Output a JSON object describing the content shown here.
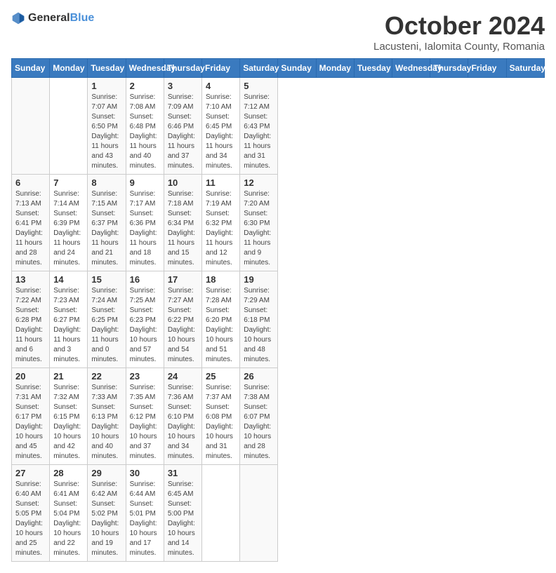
{
  "header": {
    "logo_general": "General",
    "logo_blue": "Blue",
    "month": "October 2024",
    "location": "Lacusteni, Ialomita County, Romania"
  },
  "days_of_week": [
    "Sunday",
    "Monday",
    "Tuesday",
    "Wednesday",
    "Thursday",
    "Friday",
    "Saturday"
  ],
  "weeks": [
    [
      {
        "day": "",
        "info": ""
      },
      {
        "day": "",
        "info": ""
      },
      {
        "day": "1",
        "info": "Sunrise: 7:07 AM\nSunset: 6:50 PM\nDaylight: 11 hours and 43 minutes."
      },
      {
        "day": "2",
        "info": "Sunrise: 7:08 AM\nSunset: 6:48 PM\nDaylight: 11 hours and 40 minutes."
      },
      {
        "day": "3",
        "info": "Sunrise: 7:09 AM\nSunset: 6:46 PM\nDaylight: 11 hours and 37 minutes."
      },
      {
        "day": "4",
        "info": "Sunrise: 7:10 AM\nSunset: 6:45 PM\nDaylight: 11 hours and 34 minutes."
      },
      {
        "day": "5",
        "info": "Sunrise: 7:12 AM\nSunset: 6:43 PM\nDaylight: 11 hours and 31 minutes."
      }
    ],
    [
      {
        "day": "6",
        "info": "Sunrise: 7:13 AM\nSunset: 6:41 PM\nDaylight: 11 hours and 28 minutes."
      },
      {
        "day": "7",
        "info": "Sunrise: 7:14 AM\nSunset: 6:39 PM\nDaylight: 11 hours and 24 minutes."
      },
      {
        "day": "8",
        "info": "Sunrise: 7:15 AM\nSunset: 6:37 PM\nDaylight: 11 hours and 21 minutes."
      },
      {
        "day": "9",
        "info": "Sunrise: 7:17 AM\nSunset: 6:36 PM\nDaylight: 11 hours and 18 minutes."
      },
      {
        "day": "10",
        "info": "Sunrise: 7:18 AM\nSunset: 6:34 PM\nDaylight: 11 hours and 15 minutes."
      },
      {
        "day": "11",
        "info": "Sunrise: 7:19 AM\nSunset: 6:32 PM\nDaylight: 11 hours and 12 minutes."
      },
      {
        "day": "12",
        "info": "Sunrise: 7:20 AM\nSunset: 6:30 PM\nDaylight: 11 hours and 9 minutes."
      }
    ],
    [
      {
        "day": "13",
        "info": "Sunrise: 7:22 AM\nSunset: 6:28 PM\nDaylight: 11 hours and 6 minutes."
      },
      {
        "day": "14",
        "info": "Sunrise: 7:23 AM\nSunset: 6:27 PM\nDaylight: 11 hours and 3 minutes."
      },
      {
        "day": "15",
        "info": "Sunrise: 7:24 AM\nSunset: 6:25 PM\nDaylight: 11 hours and 0 minutes."
      },
      {
        "day": "16",
        "info": "Sunrise: 7:25 AM\nSunset: 6:23 PM\nDaylight: 10 hours and 57 minutes."
      },
      {
        "day": "17",
        "info": "Sunrise: 7:27 AM\nSunset: 6:22 PM\nDaylight: 10 hours and 54 minutes."
      },
      {
        "day": "18",
        "info": "Sunrise: 7:28 AM\nSunset: 6:20 PM\nDaylight: 10 hours and 51 minutes."
      },
      {
        "day": "19",
        "info": "Sunrise: 7:29 AM\nSunset: 6:18 PM\nDaylight: 10 hours and 48 minutes."
      }
    ],
    [
      {
        "day": "20",
        "info": "Sunrise: 7:31 AM\nSunset: 6:17 PM\nDaylight: 10 hours and 45 minutes."
      },
      {
        "day": "21",
        "info": "Sunrise: 7:32 AM\nSunset: 6:15 PM\nDaylight: 10 hours and 42 minutes."
      },
      {
        "day": "22",
        "info": "Sunrise: 7:33 AM\nSunset: 6:13 PM\nDaylight: 10 hours and 40 minutes."
      },
      {
        "day": "23",
        "info": "Sunrise: 7:35 AM\nSunset: 6:12 PM\nDaylight: 10 hours and 37 minutes."
      },
      {
        "day": "24",
        "info": "Sunrise: 7:36 AM\nSunset: 6:10 PM\nDaylight: 10 hours and 34 minutes."
      },
      {
        "day": "25",
        "info": "Sunrise: 7:37 AM\nSunset: 6:08 PM\nDaylight: 10 hours and 31 minutes."
      },
      {
        "day": "26",
        "info": "Sunrise: 7:38 AM\nSunset: 6:07 PM\nDaylight: 10 hours and 28 minutes."
      }
    ],
    [
      {
        "day": "27",
        "info": "Sunrise: 6:40 AM\nSunset: 5:05 PM\nDaylight: 10 hours and 25 minutes."
      },
      {
        "day": "28",
        "info": "Sunrise: 6:41 AM\nSunset: 5:04 PM\nDaylight: 10 hours and 22 minutes."
      },
      {
        "day": "29",
        "info": "Sunrise: 6:42 AM\nSunset: 5:02 PM\nDaylight: 10 hours and 19 minutes."
      },
      {
        "day": "30",
        "info": "Sunrise: 6:44 AM\nSunset: 5:01 PM\nDaylight: 10 hours and 17 minutes."
      },
      {
        "day": "31",
        "info": "Sunrise: 6:45 AM\nSunset: 5:00 PM\nDaylight: 10 hours and 14 minutes."
      },
      {
        "day": "",
        "info": ""
      },
      {
        "day": "",
        "info": ""
      }
    ]
  ]
}
